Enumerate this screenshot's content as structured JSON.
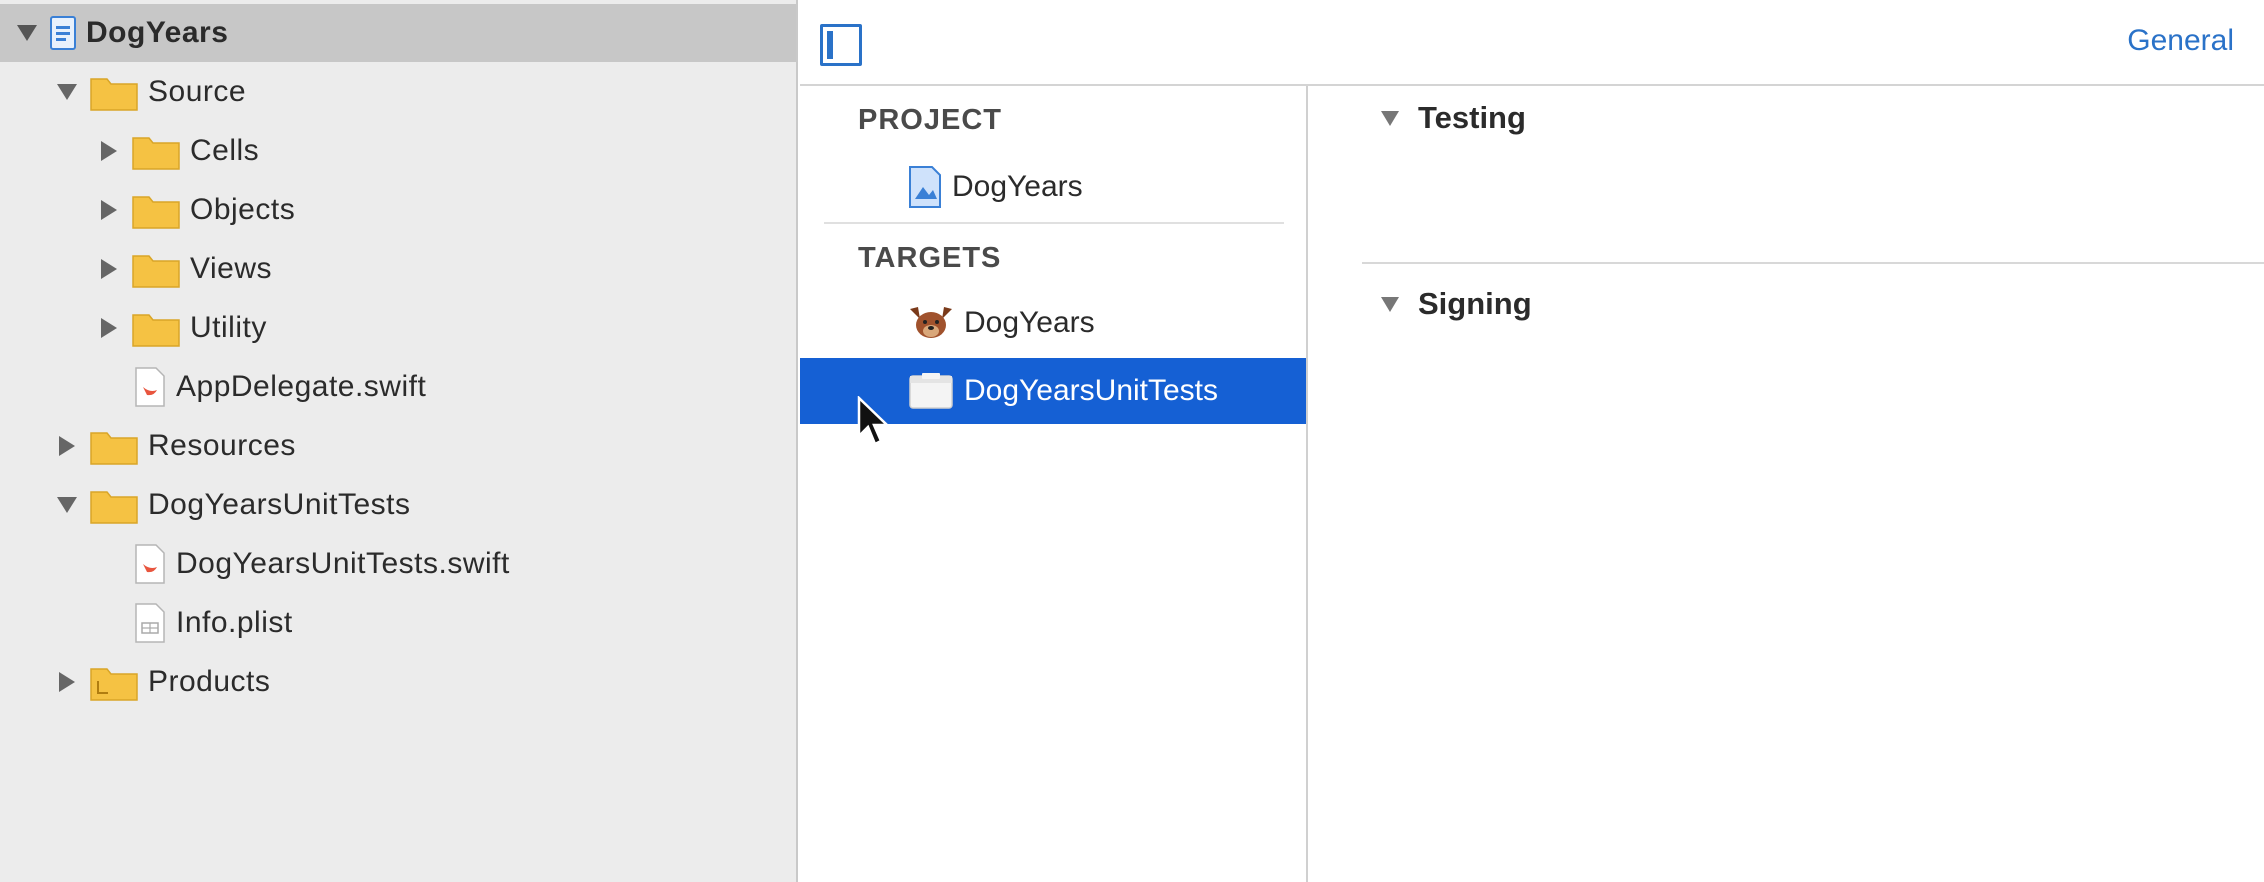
{
  "navigator": {
    "items": [
      {
        "label": "DogYears",
        "kind": "project",
        "expanded": true,
        "depth": 0
      },
      {
        "label": "Source",
        "kind": "folder",
        "expanded": true,
        "depth": 1
      },
      {
        "label": "Cells",
        "kind": "folder",
        "expanded": false,
        "depth": 2
      },
      {
        "label": "Objects",
        "kind": "folder",
        "expanded": false,
        "depth": 2
      },
      {
        "label": "Views",
        "kind": "folder",
        "expanded": false,
        "depth": 2
      },
      {
        "label": "Utility",
        "kind": "folder",
        "expanded": false,
        "depth": 2
      },
      {
        "label": "AppDelegate.swift",
        "kind": "swift-file",
        "depth": 2
      },
      {
        "label": "Resources",
        "kind": "folder",
        "expanded": false,
        "depth": 1
      },
      {
        "label": "DogYearsUnitTests",
        "kind": "folder",
        "expanded": true,
        "depth": 1
      },
      {
        "label": "DogYearsUnitTests.swift",
        "kind": "swift-file",
        "depth": 2
      },
      {
        "label": "Info.plist",
        "kind": "plist-file",
        "depth": 2
      },
      {
        "label": "Products",
        "kind": "folder",
        "expanded": false,
        "depth": 1
      }
    ]
  },
  "editor": {
    "tab_general": "General",
    "project_header": "PROJECT",
    "project_item": "DogYears",
    "targets_header": "TARGETS",
    "targets": [
      {
        "label": "DogYears",
        "icon": "dog-app-icon",
        "selected": false
      },
      {
        "label": "DogYearsUnitTests",
        "icon": "test-bundle-icon",
        "selected": true
      }
    ],
    "sections": [
      {
        "label": "Testing",
        "expanded": true
      },
      {
        "label": "Signing",
        "expanded": true
      }
    ]
  },
  "colors": {
    "accent": "#2a72c8",
    "selection": "#1560d4",
    "folder": "#f5c243",
    "navigator_bg": "#ececec"
  }
}
